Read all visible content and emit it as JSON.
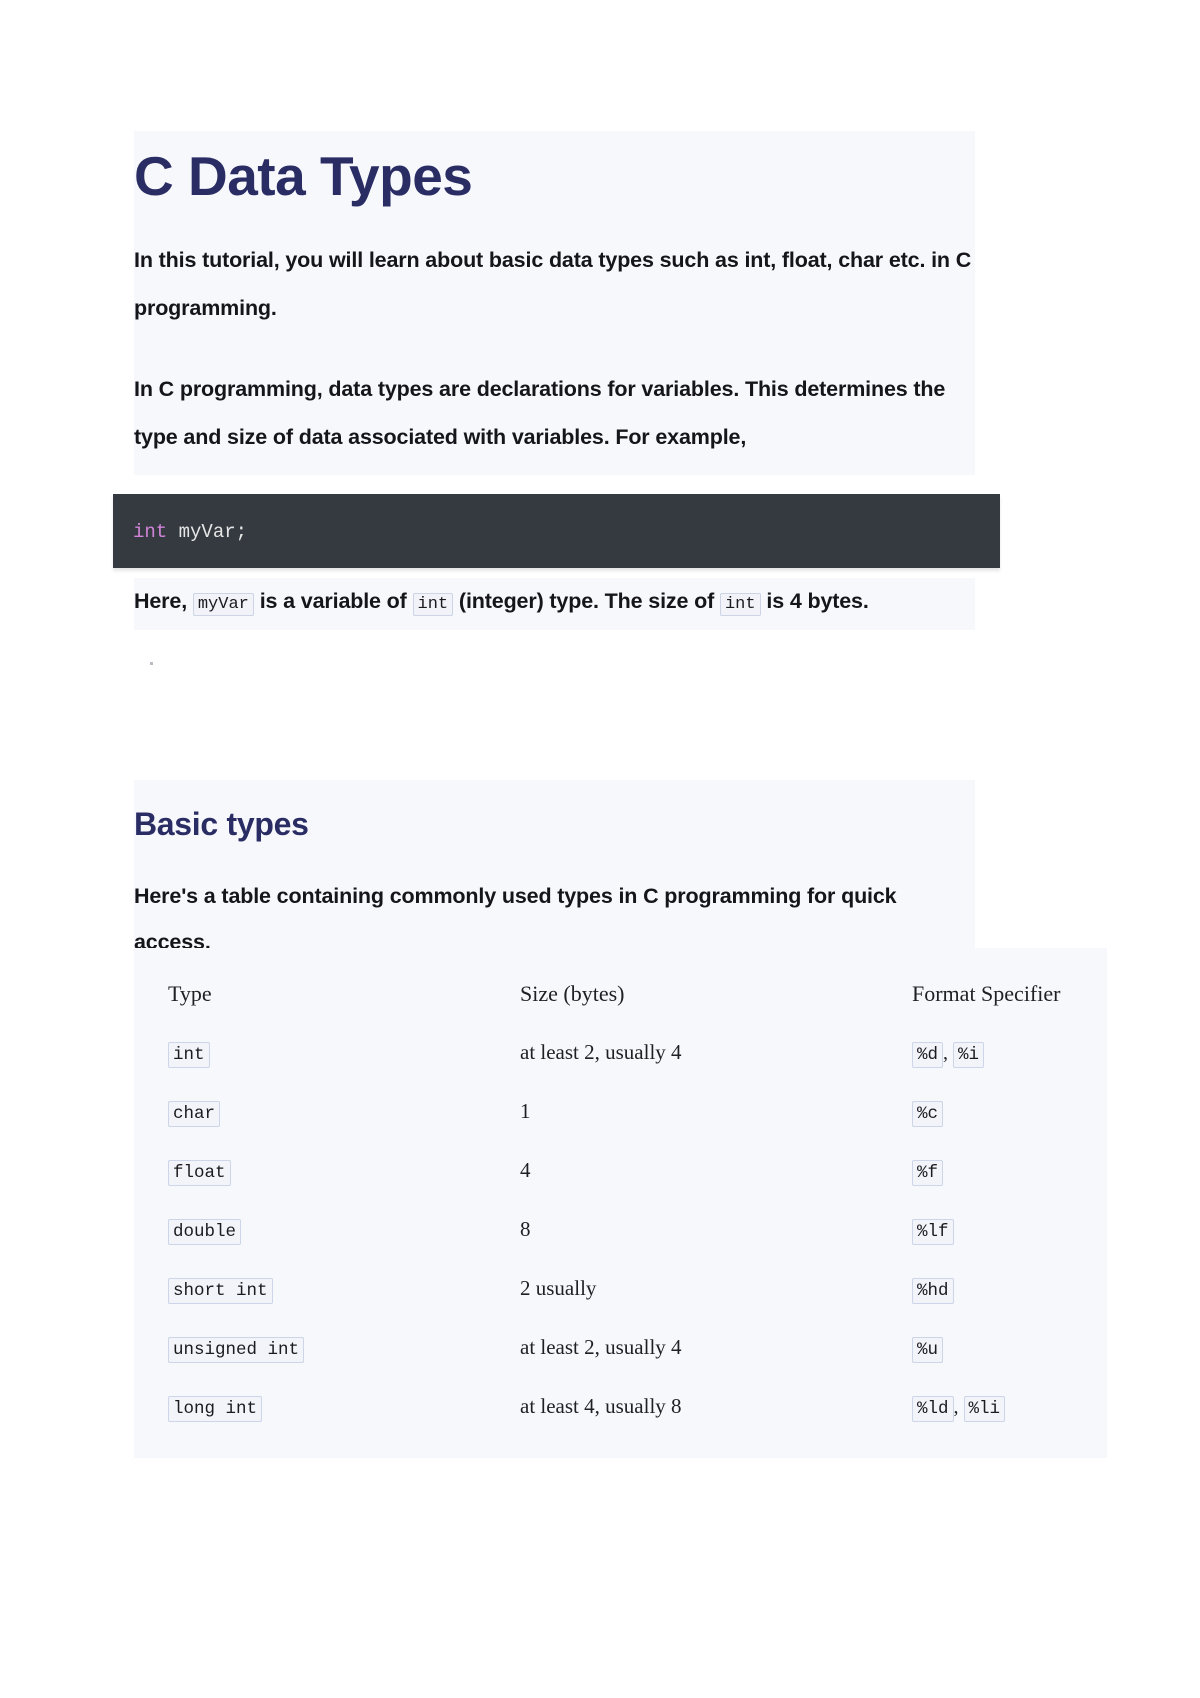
{
  "document": {
    "title": "C Data Types",
    "intro_paragraphs": [
      "In this tutorial, you will learn about basic data types such as int, float, char etc. in C programming.",
      "In C programming, data types are declarations for variables. This determines the type and size of data associated with variables. For example,"
    ],
    "code_block": {
      "language_keyword": "int",
      "rest": " myVar;",
      "full_text": "int myVar;",
      "background_color": "#343a40",
      "keyword_color": "#d083d8"
    },
    "explanation": {
      "prefix": "Here, ",
      "code_1": "myVar",
      "mid_1": " is a variable of ",
      "code_2": "int",
      "mid_2": " (integer) type. The size of ",
      "code_3": "int",
      "suffix": " is 4 bytes."
    },
    "section": {
      "heading": "Basic types",
      "paragraph": "Here's a table containing commonly used types in C programming for quick access."
    },
    "table": {
      "headers": [
        "Type",
        "Size (bytes)",
        "Format Specifier"
      ],
      "rows": [
        {
          "type": "int",
          "size": "at least 2, usually 4",
          "format": [
            "%d",
            "%i"
          ]
        },
        {
          "type": "char",
          "size": "1",
          "format": [
            "%c"
          ]
        },
        {
          "type": "float",
          "size": "4",
          "format": [
            "%f"
          ]
        },
        {
          "type": "double",
          "size": "8",
          "format": [
            "%lf"
          ]
        },
        {
          "type": "short int",
          "size": "2 usually",
          "format": [
            "%hd"
          ]
        },
        {
          "type": "unsigned int",
          "size": "at least 2, usually 4",
          "format": [
            "%u"
          ]
        },
        {
          "type": "long int",
          "size": "at least 4, usually 8",
          "format": [
            "%ld",
            "%li"
          ]
        }
      ]
    },
    "theme": {
      "heading_color": "#2a2d64",
      "panel_background": "#f7f8fc",
      "page_background": "#ffffff",
      "body_text_color": "#16161a",
      "inline_code_background": "#f1f3f8",
      "inline_code_border": "#ccd4e6"
    }
  }
}
